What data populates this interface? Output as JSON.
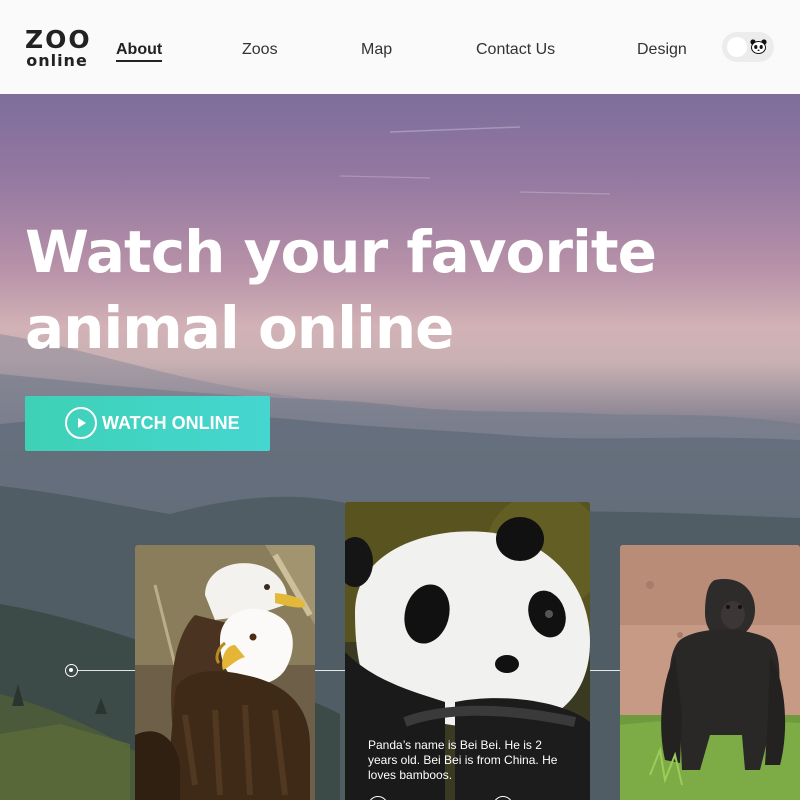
{
  "logo": {
    "line1": "ZOO",
    "line2": "online"
  },
  "nav": {
    "items": [
      {
        "label": "About",
        "active": true
      },
      {
        "label": "Zoos",
        "active": false
      },
      {
        "label": "Map",
        "active": false
      },
      {
        "label": "Contact Us",
        "active": false
      },
      {
        "label": "Design",
        "active": false
      }
    ]
  },
  "theme_toggle": {
    "icon": "panda-icon",
    "state": "off"
  },
  "hero": {
    "headline_line1": "Watch your favorite",
    "headline_line2": "animal online",
    "cta_label": "WATCH ONLINE",
    "cta_icon": "play-icon",
    "cta_colors": [
      "#3ed1b6",
      "#45d6d0"
    ]
  },
  "carousel": {
    "cards": [
      {
        "animal": "eagle",
        "active": false
      },
      {
        "animal": "panda",
        "active": true,
        "caption": "Panda’s name is Bei Bei. He is 2 years old. Bei Bei is from China. He loves bamboos."
      },
      {
        "animal": "gorilla",
        "active": false
      }
    ]
  }
}
